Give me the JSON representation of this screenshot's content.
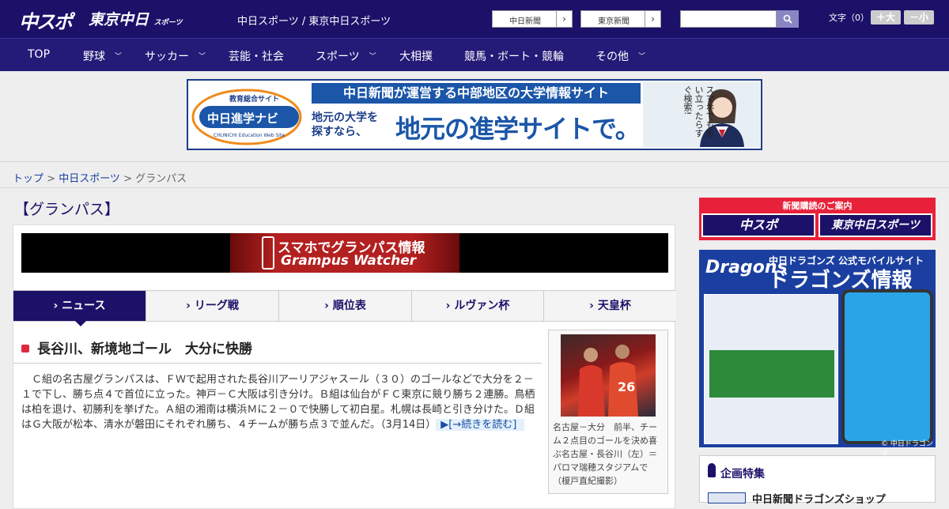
{
  "header": {
    "logo_main": "中スポ",
    "logo_tokyo": "東京中日",
    "logo_sports": "スポーツ",
    "site_name": "中日スポーツ / 東京中日スポーツ",
    "link_chunichi": "中日新聞",
    "link_tokyo": "東京新聞",
    "arrow": "›",
    "search_placeholder": "",
    "search_icon": "search-icon",
    "font_label": "文字（0）",
    "font_larger": "＋大",
    "font_smaller": "－小"
  },
  "nav": {
    "items": [
      {
        "label": "TOP",
        "has_menu": false
      },
      {
        "label": "野球",
        "has_menu": true
      },
      {
        "label": "サッカー",
        "has_menu": true
      },
      {
        "label": "芸能・社会",
        "has_menu": false
      },
      {
        "label": "スポーツ",
        "has_menu": true
      },
      {
        "label": "大相撲",
        "has_menu": false
      },
      {
        "label": "競馬・ボート・競輪",
        "has_menu": false
      },
      {
        "label": "その他",
        "has_menu": true
      }
    ],
    "chevron": "﹀"
  },
  "ad_banner": {
    "badge_small": "教育総合サイト",
    "logo_text": "中日進学ナビ",
    "logo_sub": "CHUNICHI Education Web Site",
    "headline": "中日新聞が運営する中部地区の大学情報サイト",
    "sub_left": "地元の大学を\n探すなら、",
    "big": "地元の進学サイトで。",
    "vertical": "スマホでも思い立ったらすぐ検索!"
  },
  "breadcrumb": {
    "top": "トップ",
    "sep": " > ",
    "chuspo": "中日スポーツ",
    "current": "グランパス"
  },
  "section_title": "【グランパス】",
  "promo": {
    "line1": "スマホでグランパス情報",
    "line2": "Grampus Watcher"
  },
  "tabs": [
    {
      "label": "› ニュース",
      "active": true
    },
    {
      "label": "› リーグ戦",
      "active": false
    },
    {
      "label": "› 順位表",
      "active": false
    },
    {
      "label": "› ルヴァン杯",
      "active": false
    },
    {
      "label": "› 天皇杯",
      "active": false
    }
  ],
  "article": {
    "headline": "長谷川、新境地ゴール　大分に快勝",
    "body": "　Ｃ組の名古屋グランパスは、ＦＷで起用された長谷川アーリアジャスール（３０）のゴールなどで大分を２－１で下し、勝ち点４で首位に立った。神戸－Ｃ大阪は引き分け。Ｂ組は仙台がＦＣ東京に競り勝ち２連勝。鳥栖は柏を退け、初勝利を挙げた。Ａ組の湘南は横浜Ｍに２－０で快勝して初白星。札幌は長崎と引き分けた。Ｄ組はＧ大阪が松本、清水が磐田にそれぞれ勝ち、４チームが勝ち点３で並んだ。（3月14日）",
    "more": "▶[→続きを読む]",
    "photo_caption": "名古屋－大分　前半、チーム２点目のゴールを決め喜ぶ名古屋・長谷川（左）＝パロマ瑞穂スタジアムで（榎戸直紀撮影）"
  },
  "sidebar": {
    "subscribe_title": "新聞購読のご案内",
    "subscribe_chuspo": "中スポ",
    "subscribe_tokyo": "東京中日スポーツ",
    "dragons_logo": "Dragons",
    "dragons_sub": "中日ドラゴンズ 公式モバイルサイト",
    "dragons_title": "ドラゴンズ情報",
    "dragons_copy": "© 中日ドラゴンズ",
    "kikaku_title": "企画特集",
    "kikaku_item": "中日新聞ドラゴンズショップ"
  },
  "colors": {
    "brand_navy": "#1b1169",
    "nav_bg": "#241a78",
    "accent_red": "#e8213a",
    "link_blue": "#1a3fa0"
  }
}
